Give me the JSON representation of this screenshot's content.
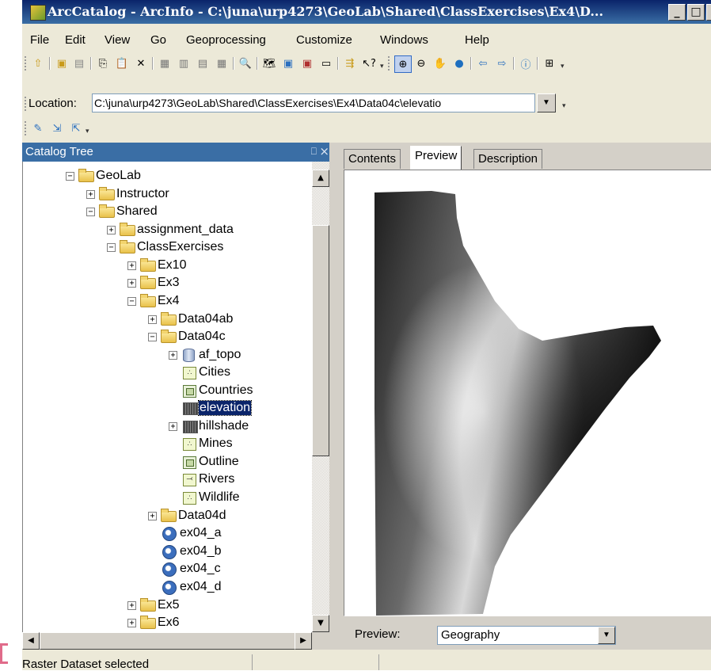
{
  "window": {
    "title": "ArcCatalog - ArcInfo - C:\\juna\\urp4273\\GeoLab\\Shared\\ClassExercises\\Ex4\\D...",
    "minimize_glyph": "_",
    "maximize_glyph": "□",
    "close_glyph": "X"
  },
  "menu": [
    "File",
    "Edit",
    "View",
    "Go",
    "Geoprocessing",
    "Customize",
    "Windows",
    "Help"
  ],
  "location": {
    "label": "Location:",
    "value": "C:\\juna\\urp4273\\GeoLab\\Shared\\ClassExercises\\Ex4\\Data04c\\elevatio"
  },
  "catalog": {
    "title": "Catalog Tree",
    "pin_glyph": "⎕",
    "close_glyph": "×",
    "items": [
      {
        "label": "GeoLab",
        "icon": "folder-icon",
        "expander": "−",
        "selected": false
      },
      {
        "label": "Instructor",
        "icon": "folder-icon",
        "expander": "+",
        "selected": false
      },
      {
        "label": "Shared",
        "icon": "folder-icon",
        "expander": "−",
        "selected": false
      },
      {
        "label": "assignment_data",
        "icon": "folder-icon",
        "expander": "+",
        "selected": false
      },
      {
        "label": "ClassExercises",
        "icon": "folder-icon",
        "expander": "−",
        "selected": false
      },
      {
        "label": "Ex10",
        "icon": "folder-icon",
        "expander": "+",
        "selected": false
      },
      {
        "label": "Ex3",
        "icon": "folder-icon",
        "expander": "+",
        "selected": false
      },
      {
        "label": "Ex4",
        "icon": "folder-icon",
        "expander": "−",
        "selected": false
      },
      {
        "label": "Data04ab",
        "icon": "folder-icon",
        "expander": "+",
        "selected": false
      },
      {
        "label": "Data04c",
        "icon": "folder-icon",
        "expander": "−",
        "selected": false
      },
      {
        "label": "af_topo",
        "icon": "database-icon",
        "expander": "+",
        "selected": false
      },
      {
        "label": "Cities",
        "icon": "point-shapefile-icon",
        "expander": "",
        "selected": false
      },
      {
        "label": "Countries",
        "icon": "polygon-shapefile-icon",
        "expander": "",
        "selected": false
      },
      {
        "label": "elevation",
        "icon": "raster-icon",
        "expander": "",
        "selected": true
      },
      {
        "label": "hillshade",
        "icon": "raster-icon",
        "expander": "+",
        "selected": false
      },
      {
        "label": "Mines",
        "icon": "point-shapefile-icon",
        "expander": "",
        "selected": false
      },
      {
        "label": "Outline",
        "icon": "polygon-shapefile-icon",
        "expander": "",
        "selected": false
      },
      {
        "label": "Rivers",
        "icon": "line-shapefile-icon",
        "expander": "",
        "selected": false
      },
      {
        "label": "Wildlife",
        "icon": "point-shapefile-icon",
        "expander": "",
        "selected": false
      },
      {
        "label": "Data04d",
        "icon": "folder-icon",
        "expander": "+",
        "selected": false
      },
      {
        "label": "ex04_a",
        "icon": "map-document-icon",
        "expander": "",
        "selected": false
      },
      {
        "label": "ex04_b",
        "icon": "map-document-icon",
        "expander": "",
        "selected": false
      },
      {
        "label": "ex04_c",
        "icon": "map-document-icon",
        "expander": "",
        "selected": false
      },
      {
        "label": "ex04_d",
        "icon": "map-document-icon",
        "expander": "",
        "selected": false
      },
      {
        "label": "Ex5",
        "icon": "folder-icon",
        "expander": "+",
        "selected": false
      },
      {
        "label": "Ex6",
        "icon": "folder-icon",
        "expander": "+",
        "selected": false
      }
    ]
  },
  "tabs": [
    "Contents",
    "Preview",
    "Description"
  ],
  "active_tab": "Preview",
  "preview": {
    "label": "Preview:",
    "mode": "Geography"
  },
  "status": {
    "text": "Raster Dataset selected"
  },
  "colors": {
    "title_bar": "#0a246a",
    "selection": "#0a246a",
    "catalog_header": "#3a6ea5"
  }
}
